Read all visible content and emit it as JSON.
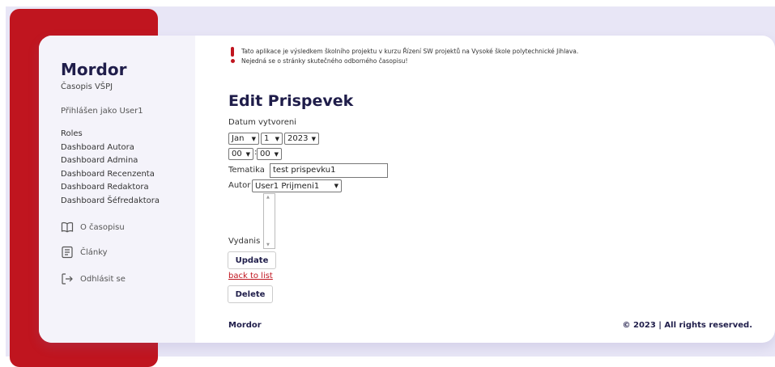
{
  "sidebar": {
    "brand": "Mordor",
    "subtitle": "Časopis VŠPJ",
    "logged_in": "Přihlášen jako User1",
    "links": [
      "Roles",
      "Dashboard Autora",
      "Dashboard Admina",
      "Dashboard Recenzenta",
      "Dashboard Redaktora",
      "Dashboard Šéfredaktora"
    ],
    "about": "O časopisu",
    "articles": "Články",
    "logout": "Odhlásit se"
  },
  "notice": {
    "line1": "Tato aplikace je výsledkem školního projektu v kurzu Řízení SW projektů na Vysoké škole polytechnické Jihlava.",
    "line2": "Nejedná se o stránky skutečného odborného časopisu!"
  },
  "form": {
    "title": "Edit Prispevek",
    "date_label": "Datum vytvoreni",
    "month": "Jan",
    "day": "1",
    "year": "2023",
    "hour": "00",
    "minute": "00",
    "time_sep": ":",
    "tematika_label": "Tematika",
    "tematika_value": "test prispevku1",
    "autor_label": "Autor",
    "autor_value": "User1 Prijmeni1",
    "vydanis_label": "Vydanis",
    "update_label": "Update",
    "back_label": "back to list",
    "delete_label": "Delete"
  },
  "footer": {
    "brand": "Mordor",
    "copyright": "© 2023 | All rights reserved."
  },
  "colors": {
    "accent": "#c0151f",
    "navy": "#1f1d4a",
    "lavender": "#e8e6f6"
  },
  "icons": {
    "about": "book-open-icon",
    "articles": "document-list-icon",
    "logout": "logout-arrow-icon",
    "chevron": "chevron-down-icon"
  }
}
